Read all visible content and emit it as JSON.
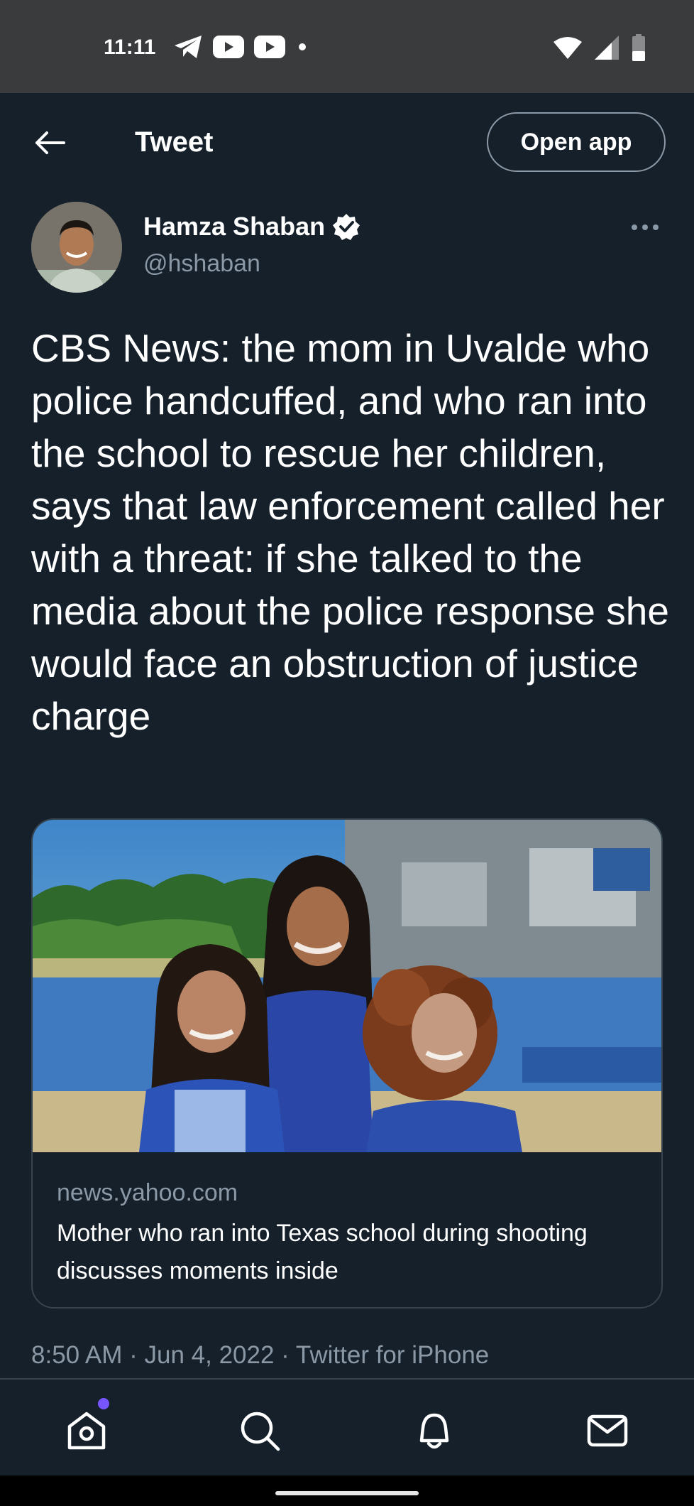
{
  "status_bar": {
    "time": "11:11",
    "left_icons": [
      "telegram-icon",
      "youtube-icon",
      "youtube-icon",
      "notification-dot-icon"
    ],
    "right_icons": [
      "wifi-icon",
      "signal-icon",
      "battery-icon"
    ]
  },
  "appbar": {
    "title": "Tweet",
    "open_app_label": "Open app"
  },
  "author": {
    "name": "Hamza Shaban",
    "handle": "@hshaban",
    "verified": true
  },
  "tweet": {
    "text": "CBS News: the mom in Uvalde who police handcuffed, and who ran into the school to rescue her children, says that law enforcement called her with a threat: if she talked to the media about the police response she would face an obstruction of justice charge",
    "meta": "8:50 AM · Jun 4, 2022 · Twitter for iPhone"
  },
  "link_card": {
    "domain": "news.yahoo.com",
    "title": "Mother who ran into Texas school during shooting discusses moments inside"
  },
  "bottom_nav": {
    "items": [
      "home-icon",
      "search-icon",
      "notifications-icon",
      "messages-icon"
    ],
    "accent": "#7856ff"
  },
  "colors": {
    "background": "#15202b",
    "secondary_text": "#8b98a5",
    "border": "#38444d",
    "status_bar": "#3a3b3d"
  }
}
